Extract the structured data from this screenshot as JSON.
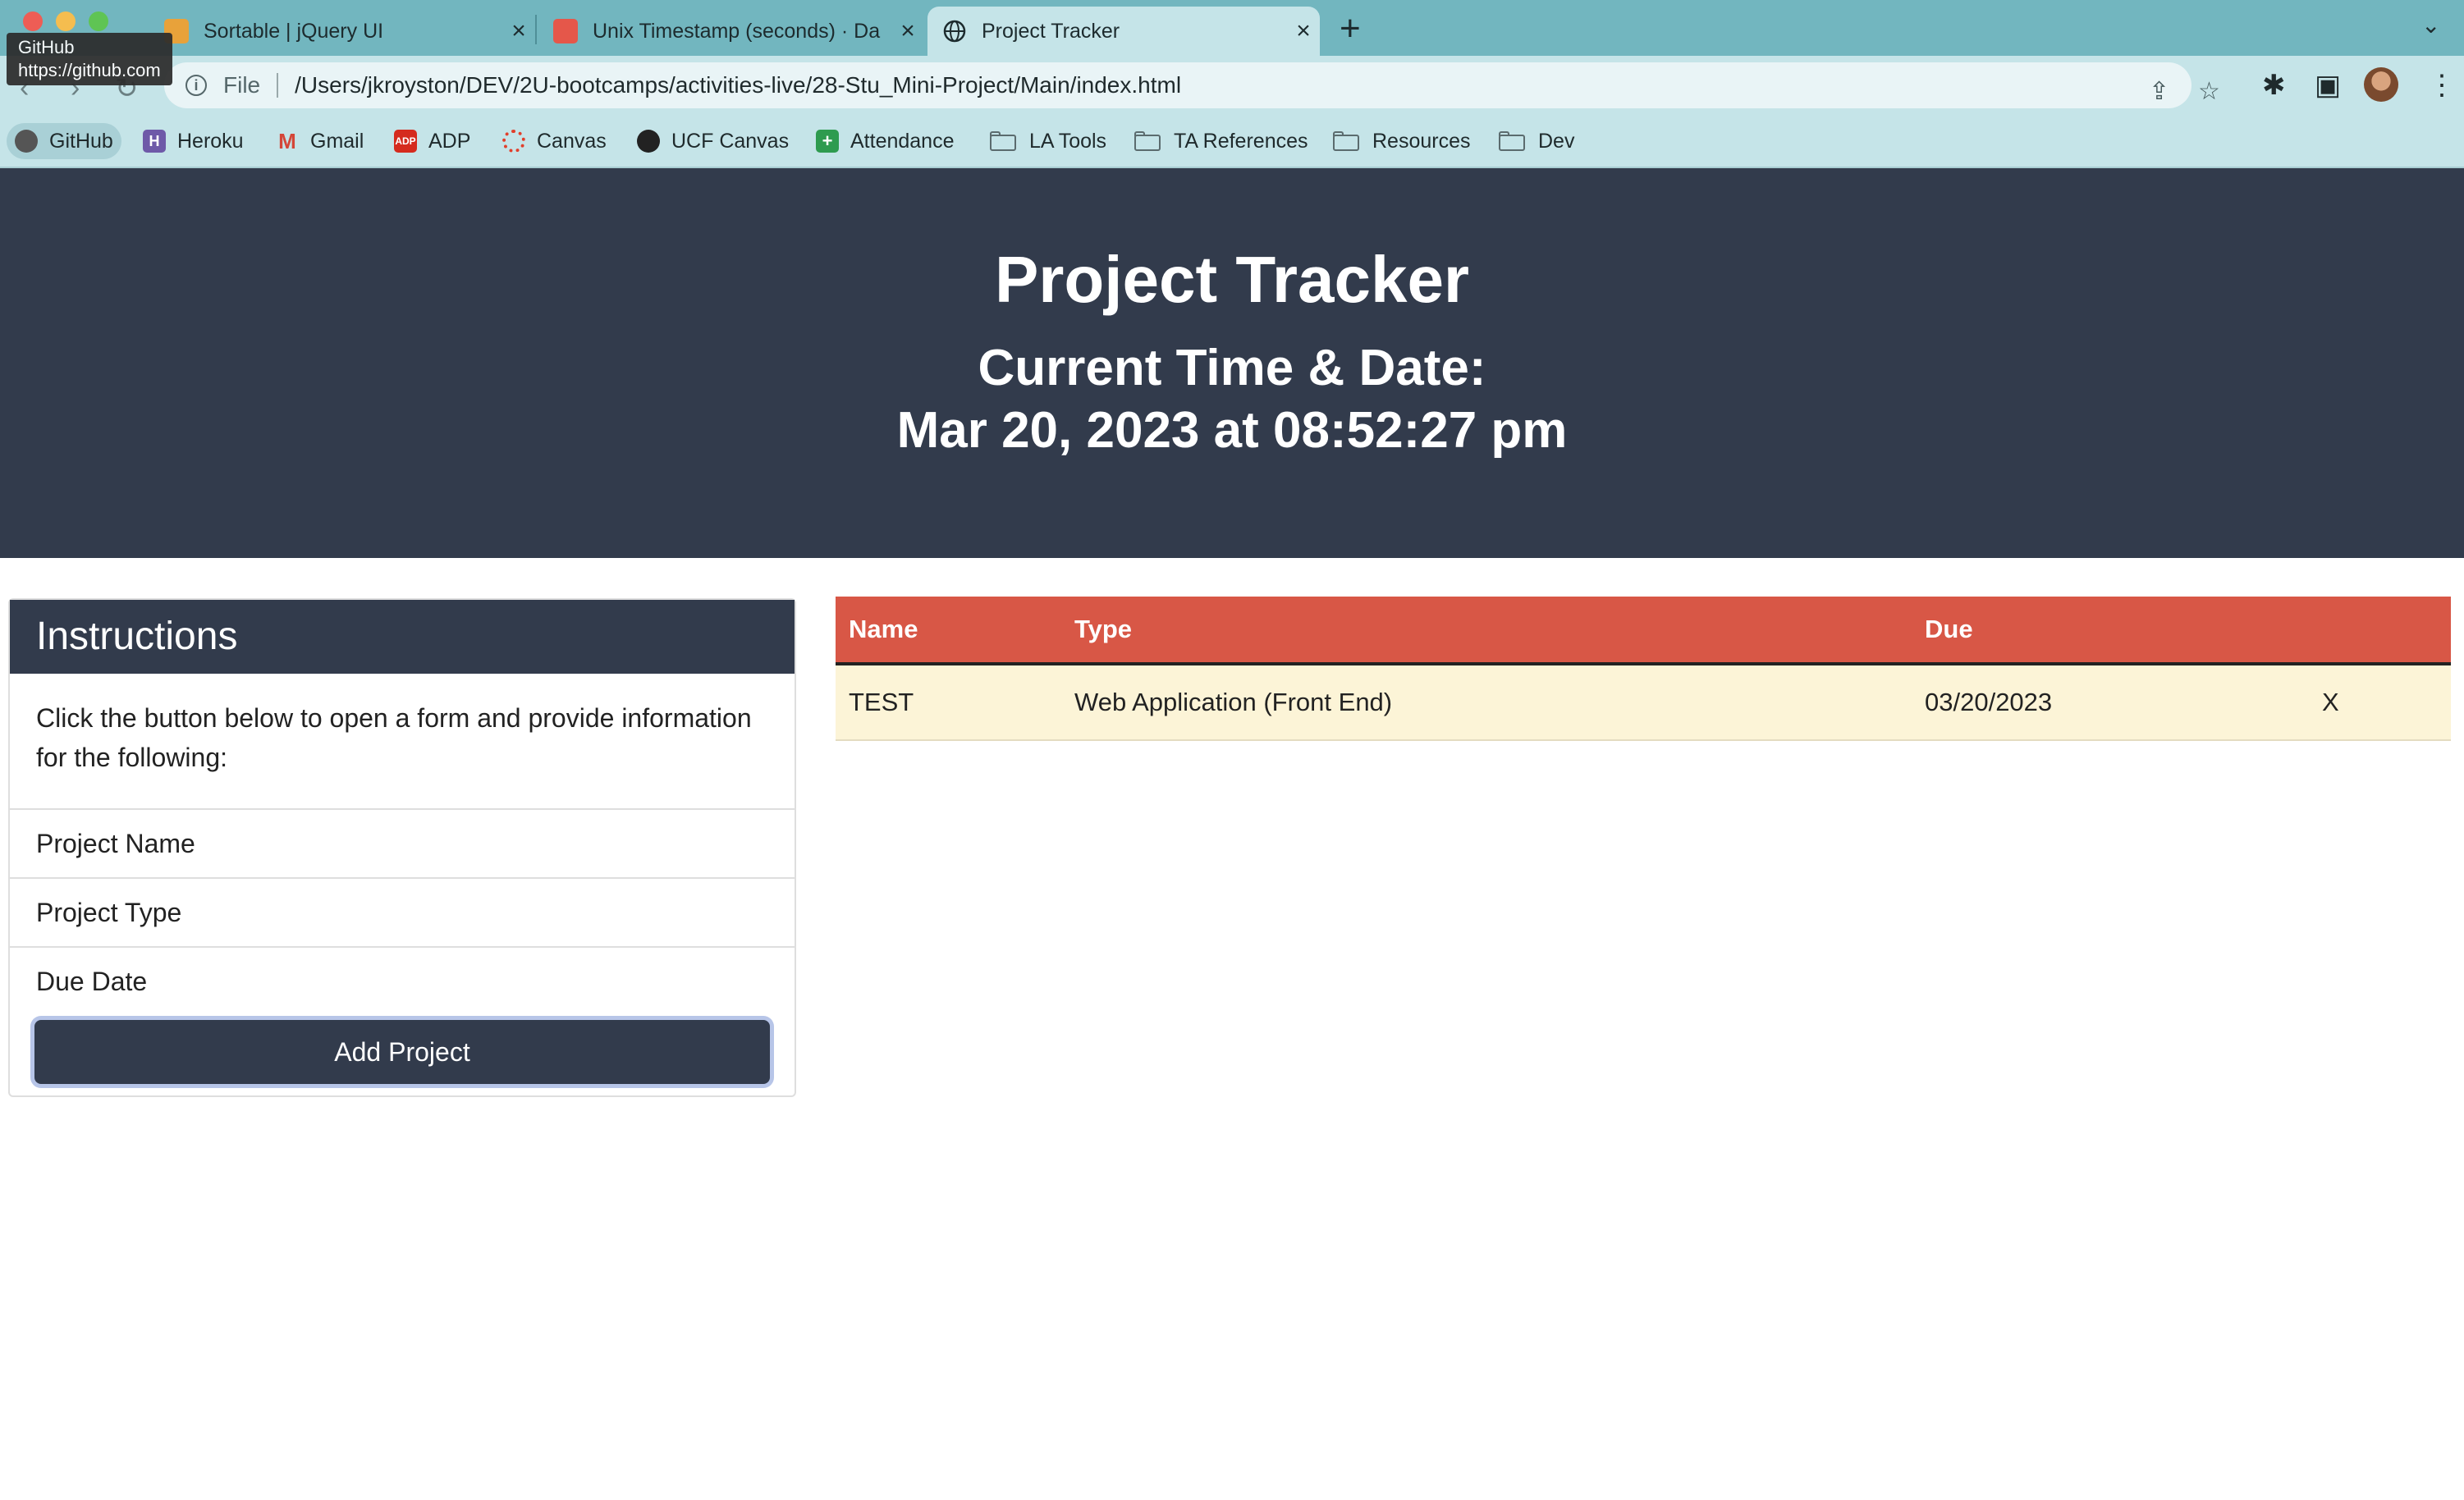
{
  "browser": {
    "tabs": [
      {
        "title": "Sortable | jQuery UI",
        "active": false
      },
      {
        "title": "Unix Timestamp (seconds) · Da",
        "active": false
      },
      {
        "title": "Project Tracker",
        "active": true
      }
    ],
    "address_scheme": "File",
    "address_url": "/Users/jkroyston/DEV/2U-bootcamps/activities-live/28-Stu_Mini-Project/Main/index.html",
    "tooltip": {
      "title": "GitHub",
      "url": "https://github.com"
    },
    "bookmarks": [
      {
        "label": "GitHub",
        "icon": "github-icon"
      },
      {
        "label": "Heroku",
        "icon": "heroku-icon"
      },
      {
        "label": "Gmail",
        "icon": "gmail-icon"
      },
      {
        "label": "ADP",
        "icon": "adp-icon"
      },
      {
        "label": "Canvas",
        "icon": "canvas-icon"
      },
      {
        "label": "UCF Canvas",
        "icon": "ucf-icon"
      },
      {
        "label": "Attendance",
        "icon": "attendance-icon"
      },
      {
        "label": "LA Tools",
        "icon": "folder-icon"
      },
      {
        "label": "TA References",
        "icon": "folder-icon"
      },
      {
        "label": "Resources",
        "icon": "folder-icon"
      },
      {
        "label": "Dev",
        "icon": "folder-icon"
      }
    ]
  },
  "header": {
    "title": "Project Tracker",
    "datetime_label": "Current Time & Date:",
    "datetime_value": "Mar 20, 2023 at 08:52:27 pm"
  },
  "instructions": {
    "heading": "Instructions",
    "text": "Click the button below to open a form and provide information for the following:",
    "items": [
      "Project Name",
      "Project Type",
      "Due Date"
    ],
    "button_label": "Add Project"
  },
  "projects": {
    "columns": [
      "Name",
      "Type",
      "Due"
    ],
    "rows": [
      {
        "name": "TEST",
        "type": "Web Application (Front End)",
        "due": "03/20/2023",
        "delete": "X"
      }
    ]
  },
  "colors": {
    "header_bg": "#323b4c",
    "table_header": "#d85746",
    "table_row": "#fcf4d7",
    "tab_strip": "#72b6bf",
    "toolbar": "#c5e4e8"
  }
}
